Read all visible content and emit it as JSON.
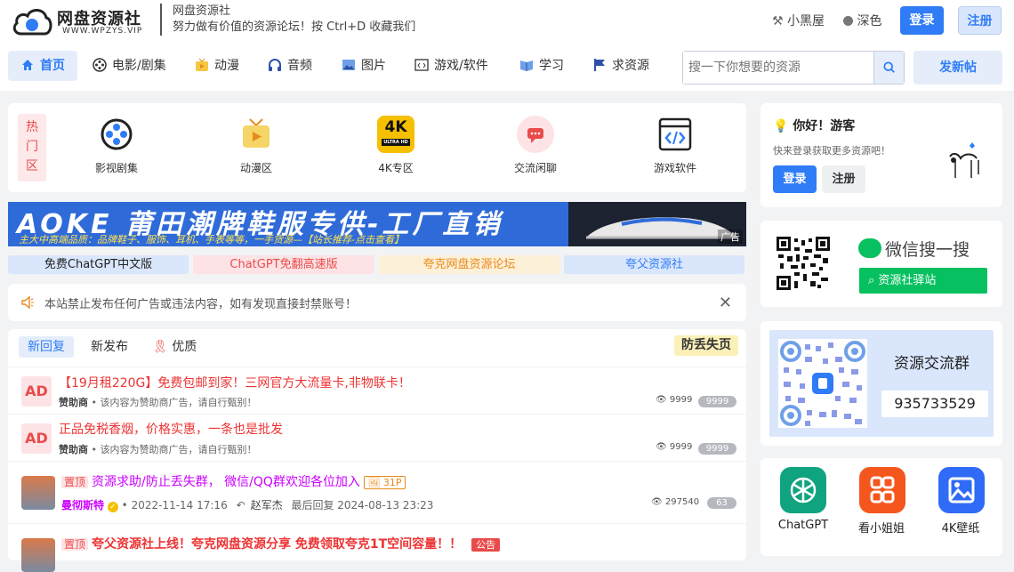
{
  "header": {
    "logo_title": "网盘资源社",
    "logo_url": "WWW.WPZYS.VIP",
    "site_name": "网盘资源社",
    "site_slogan": "努力做有价值的资源论坛！按 Ctrl+D 收藏我们",
    "black_room": "小黑屋",
    "dark_mode": "深色",
    "login": "登录",
    "register": "注册"
  },
  "nav": {
    "items": [
      "首页",
      "电影/剧集",
      "动漫",
      "音频",
      "图片",
      "游戏/软件",
      "学习",
      "求资源"
    ],
    "search_placeholder": "搜一下你想要的资源",
    "post_button": "发新帖"
  },
  "hot": {
    "tag": "热门区",
    "categories": [
      "影视剧集",
      "动漫区",
      "4K专区",
      "交流闲聊",
      "游戏软件"
    ],
    "fourk_badge": "4K",
    "fourk_sub": "ULTRA HD"
  },
  "banner": {
    "title": "AOKE 莆田潮牌鞋服专供-工厂直销",
    "subtitle": "主大中高端品质：品牌鞋子、服饰、耳机、手表等等，一手货源—【站长推荐-点击查看】",
    "ad": "广告"
  },
  "pills": [
    {
      "label": "免费ChatGPT中文版",
      "bg": "#d9e6fb",
      "color": "#222"
    },
    {
      "label": "ChatGPT免翻高速版",
      "bg": "#fde3e5",
      "color": "#e94b4b"
    },
    {
      "label": "夸克网盘资源论坛",
      "bg": "#fdf0d8",
      "color": "#e98a1b"
    },
    {
      "label": "夸父资源社",
      "bg": "#d9e6fb",
      "color": "#2f7cf6"
    }
  ],
  "notice": "本站禁止发布任何广告或违法内容，如有发现直接封禁账号！",
  "tabs": {
    "items": [
      "新回复",
      "新发布",
      "优质"
    ],
    "anti_lost": "防丢失页"
  },
  "posts": [
    {
      "badge": "AD",
      "title": "【19月租220G】免费包邮到家！三网官方大流量卡,非物联卡！",
      "author": "赞助商",
      "meta": "• 该内容为赞助商广告，请自行甄别！",
      "views": "9999",
      "count": "9999"
    },
    {
      "badge": "AD",
      "title": "正品免税香烟，价格实惠，一条也是批发",
      "author": "赞助商",
      "meta": "• 该内容为赞助商广告，请自行甄别！",
      "views": "9999",
      "count": "9999"
    },
    {
      "badge": "置顶",
      "title": "资源求助/防止丢失群， 微信/QQ群欢迎各位加入",
      "attach": "31P",
      "author": "曼彻斯特",
      "date": "• 2022-11-14 17:16",
      "replier": "赵军杰",
      "last": "最后回复 2024-08-13 23:23",
      "views": "297540",
      "count": "63"
    },
    {
      "badge": "置顶",
      "title": "夸父资源社上线！夸克网盘资源分享 免费领取夸克1T空间容量！！",
      "tag": "公告"
    }
  ],
  "sidebar": {
    "greeting": "你好！游客",
    "hint": "快来登录获取更多资源吧！",
    "login": "登录",
    "register": "注册",
    "wechat_search": "微信搜一搜",
    "wechat_button": "资源社驿站",
    "group_title": "资源交流群",
    "group_number": "935733529",
    "apps": [
      "ChatGPT",
      "看小姐姐",
      "4K壁纸"
    ]
  },
  "colors": {
    "accent": "#2f7cf6",
    "danger": "#e94b4b",
    "wechat": "#07c160"
  }
}
